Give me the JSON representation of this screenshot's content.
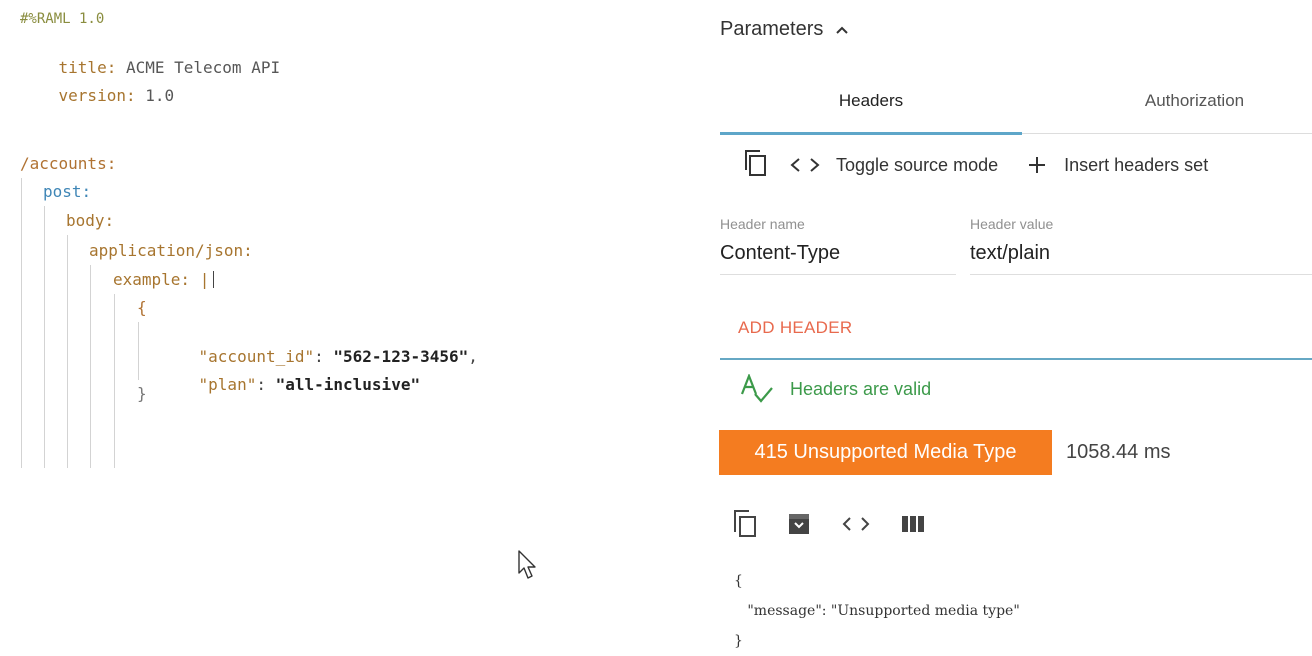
{
  "editor": {
    "raml_header": "#%RAML 1.0",
    "title_key": "title:",
    "title_value": "ACME Telecom API",
    "version_key": "version:",
    "version_value": "1.0",
    "resource": "/accounts:",
    "method": "post:",
    "body_key": "body:",
    "media_type": "application/json:",
    "example_key": "example: |",
    "open_brace": "{",
    "account_key": "\"account_id\"",
    "account_value": "\"562-123-3456\"",
    "plan_key": "\"plan\"",
    "plan_value": "\"all-inclusive\"",
    "close_brace": "}"
  },
  "panel": {
    "parameters_title": "Parameters",
    "tabs": [
      {
        "label": "Headers",
        "active": true
      },
      {
        "label": "Authorization",
        "active": false
      }
    ],
    "toolbar": {
      "toggle_source": "Toggle source mode",
      "insert_headers": "Insert headers set"
    },
    "header_name_label": "Header name",
    "header_name_value": "Content-Type",
    "header_value_label": "Header value",
    "header_value_value": "text/plain",
    "add_header": "ADD HEADER",
    "valid_text": "Headers are valid",
    "status_text": "415 Unsupported Media Type",
    "timing": "1058.44 ms",
    "response": {
      "open": "{",
      "message_line": "\"message\": \"Unsupported media type\"",
      "close": "}"
    }
  },
  "colors": {
    "accent_tab": "#5ea6c9",
    "status_bg": "#f47c20",
    "add_header": "#e8694d",
    "valid": "#3c9a4a"
  }
}
